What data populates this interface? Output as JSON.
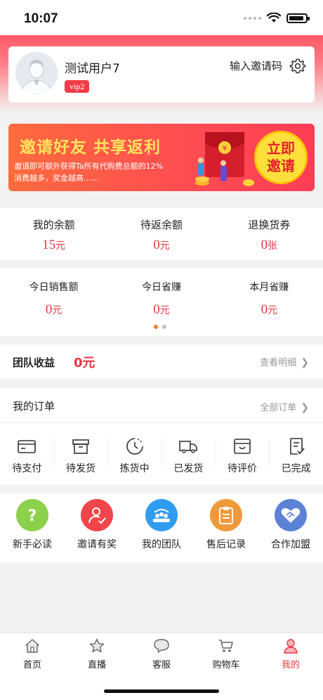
{
  "status_bar": {
    "time": "10:07"
  },
  "profile": {
    "username": "测试用户7",
    "vip_badge": "vip2",
    "invite_code_label": "输入邀请码"
  },
  "banner": {
    "title": "邀请好友 共享返利",
    "description_line1": "邀请即可额外获得Ta所有代购费总额的12%",
    "description_line2": "消费越多，奖金越高……",
    "button_line1": "立即",
    "button_line2": "邀请"
  },
  "balances": [
    {
      "label": "我的余额",
      "value": "15",
      "unit": "元"
    },
    {
      "label": "待返余额",
      "value": "0",
      "unit": "元"
    },
    {
      "label": "退换货券",
      "value": "0",
      "unit": "张"
    }
  ],
  "sales": [
    {
      "label": "今日销售额",
      "value": "0",
      "unit": "元"
    },
    {
      "label": "今日省赚",
      "value": "0",
      "unit": "元"
    },
    {
      "label": "本月省赚",
      "value": "0",
      "unit": "元"
    }
  ],
  "carousel": {
    "active_index": 0,
    "count": 2,
    "active_color": "#f07a2c",
    "inactive_color": "#bdbdbd"
  },
  "team_income": {
    "label": "团队收益",
    "value": "0元",
    "link": "查看明细"
  },
  "orders": {
    "title": "我的订单",
    "link": "全部订单",
    "items": [
      {
        "label": "待支付",
        "icon": "card-icon"
      },
      {
        "label": "待发货",
        "icon": "box-icon"
      },
      {
        "label": "拣货中",
        "icon": "clock-icon"
      },
      {
        "label": "已发货",
        "icon": "truck-icon"
      },
      {
        "label": "待评价",
        "icon": "review-icon"
      },
      {
        "label": "已完成",
        "icon": "done-icon"
      }
    ]
  },
  "services": [
    {
      "label": "新手必读",
      "icon": "question-icon",
      "color": "#8cd04b"
    },
    {
      "label": "邀请有奖",
      "icon": "invite-user-icon",
      "color": "#f0454a"
    },
    {
      "label": "我的团队",
      "icon": "team-icon",
      "color": "#2f9cf0"
    },
    {
      "label": "售后记录",
      "icon": "clipboard-icon",
      "color": "#f0993a"
    },
    {
      "label": "合作加盟",
      "icon": "handshake-icon",
      "color": "#5b82d6"
    }
  ],
  "tabbar": [
    {
      "label": "首页",
      "icon": "home-icon",
      "active": false
    },
    {
      "label": "直播",
      "icon": "star-icon",
      "active": false
    },
    {
      "label": "客服",
      "icon": "chat-icon",
      "active": false
    },
    {
      "label": "购物车",
      "icon": "cart-icon",
      "active": false
    },
    {
      "label": "我的",
      "icon": "user-icon",
      "active": true
    }
  ],
  "colors": {
    "accent": "#e8353f",
    "tab_active": "#e8353f"
  }
}
